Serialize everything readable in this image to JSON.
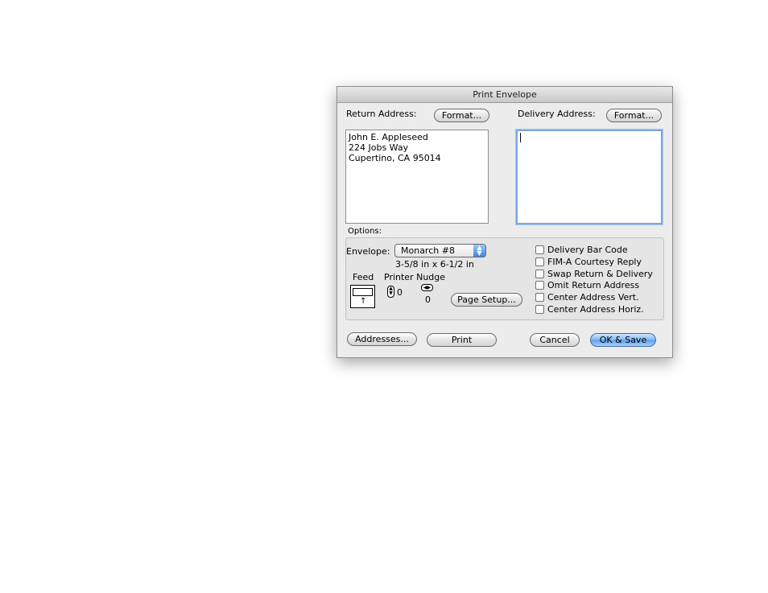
{
  "dialog": {
    "title": "Print Envelope",
    "return_address": {
      "label": "Return Address:",
      "format_button": "Format...",
      "lines": [
        "John E. Appleseed",
        "224 Jobs Way",
        "Cupertino, CA 95014"
      ]
    },
    "delivery_address": {
      "label": "Delivery Address:",
      "format_button": "Format...",
      "value": ""
    },
    "options": {
      "label": "Options:",
      "envelope_label": "Envelope:",
      "envelope_selected": "Monarch #8",
      "envelope_size": "3-5/8 in x 6-1/2 in",
      "feed_label": "Feed",
      "printer_nudge_label": "Printer Nudge",
      "nudge_vertical": "0",
      "nudge_horizontal": "0",
      "page_setup_button": "Page Setup...",
      "checkboxes": [
        {
          "label": "Delivery Bar Code",
          "checked": false
        },
        {
          "label": "FIM-A Courtesy Reply",
          "checked": false
        },
        {
          "label": "Swap Return & Delivery",
          "checked": false
        },
        {
          "label": "Omit Return Address",
          "checked": false
        },
        {
          "label": "Center Address Vert.",
          "checked": false
        },
        {
          "label": "Center Address Horiz.",
          "checked": false
        }
      ]
    },
    "buttons": {
      "addresses": "Addresses...",
      "print": "Print",
      "cancel": "Cancel",
      "ok_save": "OK & Save"
    }
  }
}
